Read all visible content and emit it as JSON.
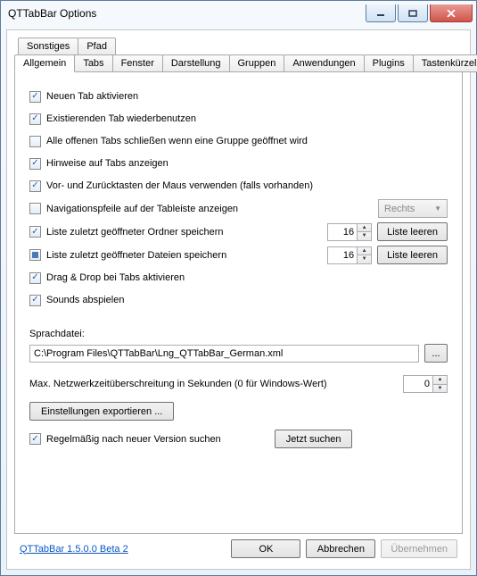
{
  "window": {
    "title": "QTTabBar Options"
  },
  "tabs": {
    "row1": [
      {
        "label": "Sonstiges"
      },
      {
        "label": "Pfad"
      }
    ],
    "row2": [
      {
        "label": "Allgemein"
      },
      {
        "label": "Tabs"
      },
      {
        "label": "Fenster"
      },
      {
        "label": "Darstellung"
      },
      {
        "label": "Gruppen"
      },
      {
        "label": "Anwendungen"
      },
      {
        "label": "Plugins"
      },
      {
        "label": "Tastenkürzel"
      }
    ]
  },
  "options": {
    "activate_new_tab": "Neuen Tab aktivieren",
    "reuse_existing_tab": "Existierenden Tab wiederbenutzen",
    "close_all_on_group_open": "Alle offenen Tabs schließen wenn eine Gruppe geöffnet wird",
    "show_tab_hints": "Hinweise auf Tabs anzeigen",
    "mouse_back_forward": "Vor- und Zurücktasten der Maus verwenden (falls vorhanden)",
    "nav_arrows_on_tabbar": "Navigationspfeile auf der Tableiste anzeigen",
    "nav_arrows_side": "Rechts",
    "recent_folders_label": "Liste zuletzt geöffneter Ordner speichern",
    "recent_folders_count": "16",
    "clear_list": "Liste leeren",
    "recent_files_label": "Liste zuletzt geöffneter Dateien speichern",
    "recent_files_count": "16",
    "drag_drop_tabs": "Drag & Drop bei Tabs aktivieren",
    "play_sounds": "Sounds abspielen"
  },
  "lang": {
    "label": "Sprachdatei:",
    "path": "C:\\Program Files\\QTTabBar\\Lng_QTTabBar_German.xml",
    "browse": "..."
  },
  "net": {
    "label": "Max. Netzwerkzeitüberschreitung in Sekunden (0 für Windows-Wert)",
    "value": "0"
  },
  "export_btn": "Einstellungen exportieren ...",
  "update": {
    "check_label": "Regelmäßig nach neuer Version suchen",
    "now_btn": "Jetzt suchen"
  },
  "footer": {
    "version": "QTTabBar 1.5.0.0 Beta 2",
    "ok": "OK",
    "cancel": "Abbrechen",
    "apply": "Übernehmen"
  }
}
